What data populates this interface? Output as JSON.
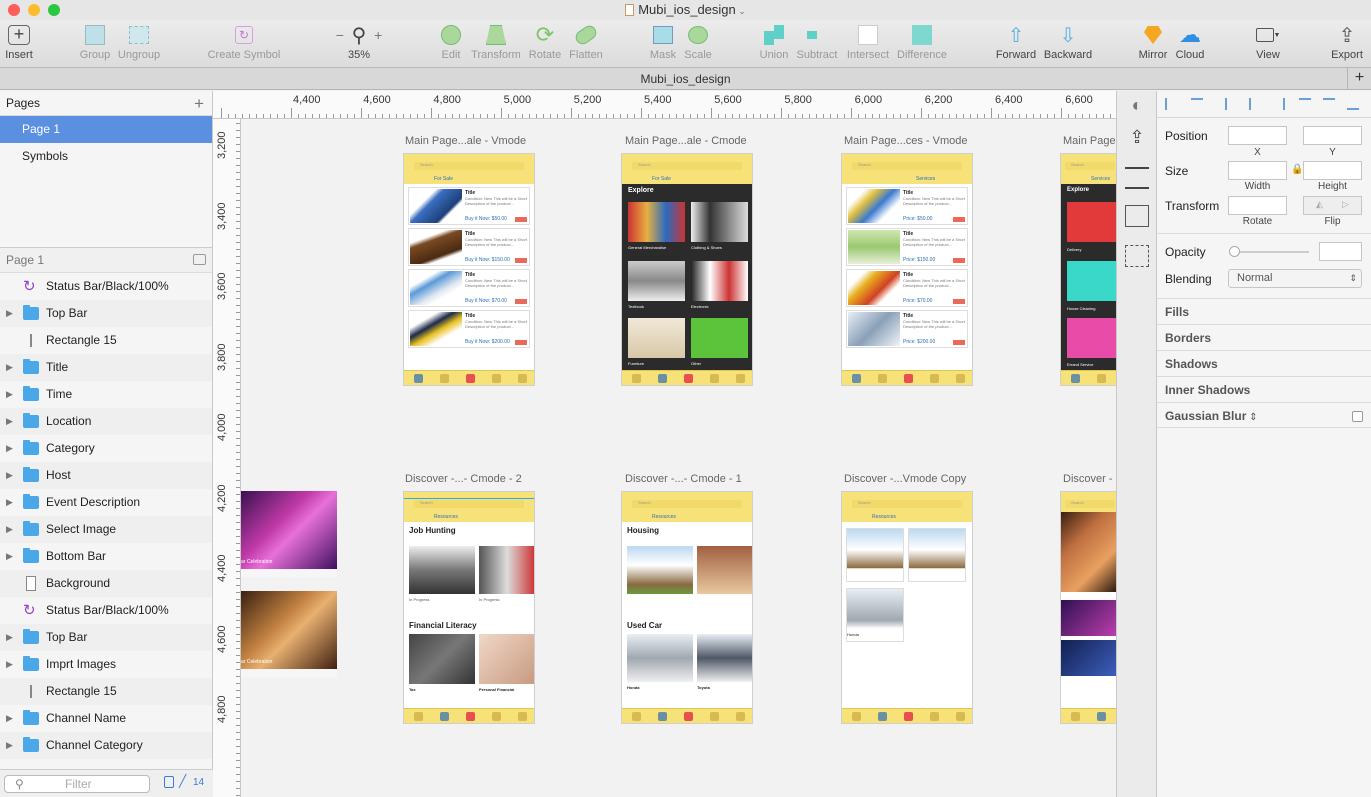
{
  "window": {
    "title": "Mubi_ios_design",
    "tab_title": "Mubi_ios_design"
  },
  "toolbar": {
    "insert": "Insert",
    "group": "Group",
    "ungroup": "Ungroup",
    "create_symbol": "Create Symbol",
    "zoom": "35%",
    "edit": "Edit",
    "transform": "Transform",
    "rotate": "Rotate",
    "flatten": "Flatten",
    "mask": "Mask",
    "scale": "Scale",
    "union": "Union",
    "subtract": "Subtract",
    "intersect": "Intersect",
    "difference": "Difference",
    "forward": "Forward",
    "backward": "Backward",
    "mirror": "Mirror",
    "cloud": "Cloud",
    "view": "View",
    "export": "Export"
  },
  "pages": {
    "header": "Pages",
    "items": [
      "Page 1",
      "Symbols"
    ]
  },
  "layers": {
    "page": "Page 1",
    "items": [
      {
        "name": "Status Bar/Black/100%",
        "type": "symbol"
      },
      {
        "name": "Top Bar",
        "type": "folder"
      },
      {
        "name": "Rectangle 15",
        "type": "rect"
      },
      {
        "name": "Title",
        "type": "folder"
      },
      {
        "name": "Time",
        "type": "folder"
      },
      {
        "name": "Location",
        "type": "folder"
      },
      {
        "name": "Category",
        "type": "folder"
      },
      {
        "name": "Host",
        "type": "folder"
      },
      {
        "name": "Event Description",
        "type": "folder"
      },
      {
        "name": "Select Image",
        "type": "folder"
      },
      {
        "name": "Bottom Bar",
        "type": "folder"
      },
      {
        "name": "Background",
        "type": "bg"
      },
      {
        "name": "Status Bar/Black/100%",
        "type": "symbol"
      },
      {
        "name": "Top Bar",
        "type": "folder"
      },
      {
        "name": "Imprt Images",
        "type": "folder"
      },
      {
        "name": "Rectangle 15",
        "type": "rect"
      },
      {
        "name": "Channel Name",
        "type": "folder"
      },
      {
        "name": "Channel Category",
        "type": "folder"
      }
    ],
    "filter_placeholder": "Filter",
    "count": "14"
  },
  "rulers": {
    "top": [
      "4,400",
      "4,600",
      "4,800",
      "5,000",
      "5,200",
      "5,400",
      "5,600",
      "5,800",
      "6,000",
      "6,200",
      "6,400",
      "6,600"
    ],
    "left": [
      "3,200",
      "3,400",
      "3,600",
      "3,800",
      "4,000",
      "4,200",
      "4,400",
      "4,600",
      "4,800"
    ]
  },
  "artboards": {
    "a1": "Main Page...ale - Vmode",
    "a2": "Main Page...ale - Cmode",
    "a3": "Main Page...ces - Vmode",
    "a4": "Main Page",
    "b1": "Discover -...- Cmode - 2",
    "b2": "Discover -...- Cmode - 1",
    "b3": "Discover -...Vmode Copy",
    "b4": "Discover -"
  },
  "mock": {
    "search": "Search",
    "for_sale": "For Sale",
    "services": "Services",
    "resources": "Resources",
    "card_title": "Title",
    "card_desc": "Condition: New This will be a Short Description of the product...",
    "price1": "Buy it Now: $50.00",
    "price2": "Buy it Now: $150.00",
    "price3": "Buy it Now: $70.00",
    "price4": "Buy it Now: $200.00",
    "sprice1": "Price: $50.00",
    "sprice2": "Price: $150.00",
    "sprice3": "Price: $70.00",
    "sprice4": "Price: $200.00",
    "explore": "Explore",
    "general": "General Merchandise",
    "clothing": "Clothing & Shoes",
    "textbook": "Textbook",
    "electronic": "Electronic",
    "furniture": "Furniture",
    "other": "Other",
    "delivery": "Delivery",
    "house": "House Cleaning",
    "errand": "Errand Service",
    "job": "Job Hunting",
    "fin": "Financial Literacy",
    "housing": "Housing",
    "usedcar": "Used Car",
    "inprog": "In Progress",
    "tax": "Tax",
    "personal": "Personal Financial",
    "honda": "Honda",
    "toyota": "Toyota",
    "ev_celebration": "ar Celebration"
  },
  "inspector": {
    "position": "Position",
    "x": "X",
    "y": "Y",
    "size": "Size",
    "width": "Width",
    "height": "Height",
    "transform": "Transform",
    "rotate": "Rotate",
    "flip": "Flip",
    "opacity": "Opacity",
    "blending": "Blending",
    "blend_value": "Normal",
    "fills": "Fills",
    "borders": "Borders",
    "shadows": "Shadows",
    "inner_shadows": "Inner Shadows",
    "gaussian_blur": "Gaussian Blur"
  },
  "colors": {
    "accent": "#5b8fdf",
    "yellow": "#f7e27a",
    "folder": "#4aa8e8"
  }
}
